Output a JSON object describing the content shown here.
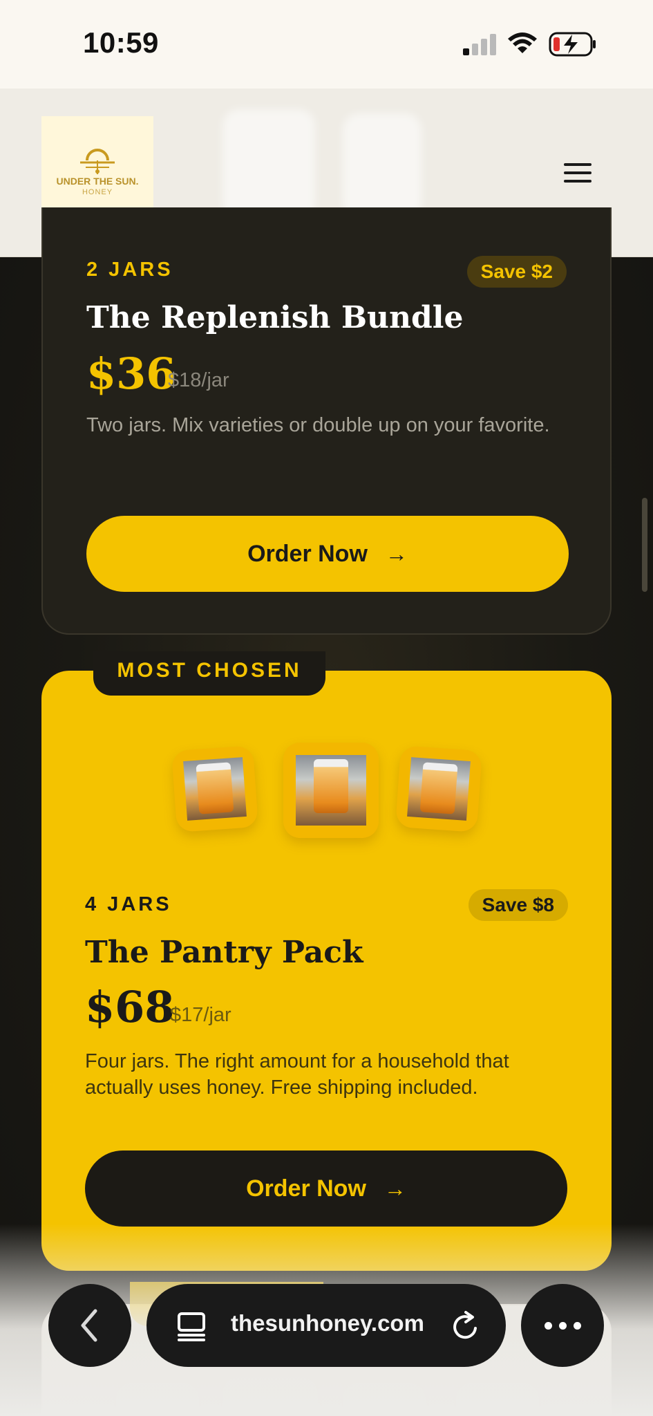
{
  "status_bar": {
    "time": "10:59"
  },
  "header": {
    "logo_title": "UNDER THE SUN.",
    "logo_subtitle": "HONEY"
  },
  "bundles": [
    {
      "jar_count": "2 JARS",
      "save": "Save $2",
      "name": "The Replenish Bundle",
      "price": "$36",
      "per_jar": "$18/jar",
      "description": "Two jars. Mix varieties or double up on your favorite.",
      "button_label": "Order Now"
    },
    {
      "ribbon": "MOST CHOSEN",
      "jar_count": "4 JARS",
      "save": "Save $8",
      "name": "The Pantry Pack",
      "price": "$68",
      "per_jar": "$17/jar",
      "description": "Four jars. The right amount for a household that actually uses honey. Free shipping included.",
      "button_label": "Order Now"
    }
  ],
  "browser": {
    "url": "thesunhoney.com"
  },
  "colors": {
    "accent": "#f4c300",
    "dark_card": "#23211a",
    "background": "#1c1b17"
  },
  "icons": {
    "arrow": "arrow-right-icon",
    "menu": "hamburger-icon",
    "back": "chevron-left-icon",
    "tabs": "tabs-icon",
    "reload": "reload-icon",
    "more": "more-icon"
  }
}
